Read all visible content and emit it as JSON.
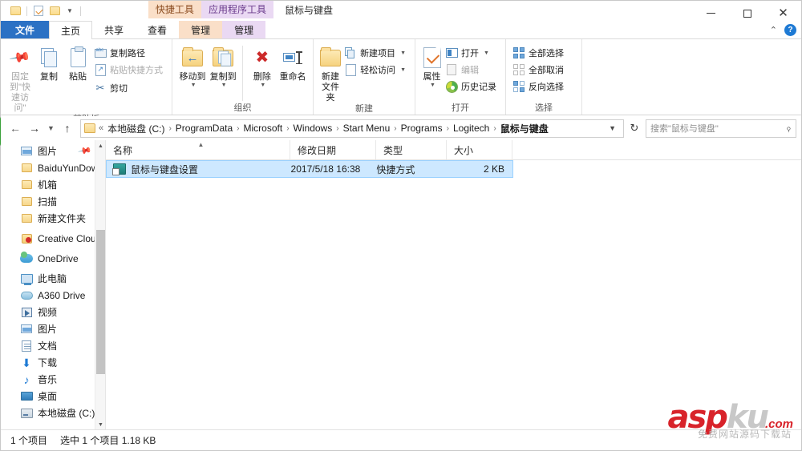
{
  "window": {
    "title": "鼠标与键盘",
    "quick_access": [
      {
        "name": "qat-folder-icon",
        "icon": "folder-mini"
      },
      {
        "name": "qat-properties-icon",
        "icon": "properties-mini"
      },
      {
        "name": "qat-newfolder-icon",
        "icon": "folder-mini"
      }
    ],
    "contextual_tabs": [
      {
        "label": "快捷工具",
        "sub": "管理",
        "color": "#fadfc8",
        "kind": "shortcut"
      },
      {
        "label": "应用程序工具",
        "sub": "管理",
        "color": "#ead9f3",
        "kind": "appcmd"
      }
    ],
    "controls": {
      "minimize": "minimize-icon",
      "maximize": "maximize-icon",
      "close": "close-icon"
    }
  },
  "ribbon": {
    "tabs": [
      {
        "label": "文件",
        "state": "file"
      },
      {
        "label": "主页",
        "state": "active"
      },
      {
        "label": "共享",
        "state": "normal"
      },
      {
        "label": "查看",
        "state": "normal"
      },
      {
        "label": "管理",
        "state": "ctx-shortcut"
      },
      {
        "label": "管理",
        "state": "ctx-appcmd"
      }
    ],
    "collapse_icon": "chevron-up-icon",
    "help_label": "?",
    "groups": [
      {
        "label": "剪贴板",
        "big": [
          {
            "label": "固定到\"快\n速访问\"",
            "line1": "固定到\"快",
            "line2": "速访问\"",
            "icon": "pin-icon",
            "dim": true
          },
          {
            "label": "复制",
            "line1": "复制",
            "line2": "",
            "icon": "copy-icon",
            "dim": false
          },
          {
            "label": "粘贴",
            "line1": "粘贴",
            "line2": "",
            "icon": "paste-icon",
            "dim": false
          }
        ],
        "small": [
          {
            "label": "复制路径",
            "icon": "copy-path-icon",
            "dim": false
          },
          {
            "label": "粘贴快捷方式",
            "icon": "paste-shortcut-icon",
            "dim": true
          },
          {
            "label": "剪切",
            "icon": "cut-icon",
            "dim": false
          }
        ]
      },
      {
        "label": "组织",
        "big": [
          {
            "line1": "移动到",
            "line2": "",
            "icon": "move-to-icon",
            "caret": true
          },
          {
            "line1": "复制到",
            "line2": "",
            "icon": "copy-to-icon",
            "caret": true
          },
          {
            "line1": "删除",
            "line2": "",
            "icon": "delete-icon",
            "caret": true
          },
          {
            "line1": "重命名",
            "line2": "",
            "icon": "rename-icon",
            "caret": false
          }
        ]
      },
      {
        "label": "新建",
        "big": [
          {
            "line1": "新建",
            "line2": "文件夹",
            "icon": "new-folder-icon",
            "caret": false
          }
        ],
        "small": [
          {
            "label": "新建项目",
            "icon": "new-item-icon",
            "caret": true
          },
          {
            "label": "轻松访问",
            "icon": "easy-access-icon",
            "caret": true
          }
        ]
      },
      {
        "label": "打开",
        "big": [
          {
            "line1": "属性",
            "line2": "",
            "icon": "properties-icon",
            "caret": true
          }
        ],
        "small": [
          {
            "label": "打开",
            "icon": "open-icon",
            "caret": true,
            "dim": false
          },
          {
            "label": "编辑",
            "icon": "edit-icon",
            "caret": false,
            "dim": true
          },
          {
            "label": "历史记录",
            "icon": "history-icon",
            "caret": false,
            "dim": false
          }
        ]
      },
      {
        "label": "选择",
        "small": [
          {
            "label": "全部选择",
            "icon": "select-all-icon"
          },
          {
            "label": "全部取消",
            "icon": "select-none-icon"
          },
          {
            "label": "反向选择",
            "icon": "invert-selection-icon"
          }
        ]
      }
    ]
  },
  "address": {
    "back_icon": "back-arrow-icon",
    "forward_icon": "forward-arrow-icon",
    "recent_icon": "chevron-down-icon",
    "up_icon": "up-arrow-icon",
    "lead_chevron": "«",
    "breadcrumbs": [
      "本地磁盘 (C:)",
      "ProgramData",
      "Microsoft",
      "Windows",
      "Start Menu",
      "Programs",
      "Logitech",
      "鼠标与键盘"
    ],
    "separator": "›",
    "dropdown_icon": "chevron-down-icon",
    "refresh_icon": "refresh-icon",
    "search_placeholder": "搜索\"鼠标与键盘\"",
    "search_value": "",
    "search_icon": "search-icon"
  },
  "navpane": {
    "items": [
      {
        "label": "图片",
        "icon": "pictures-icon",
        "indent": 1,
        "pinned": true
      },
      {
        "label": "BaiduYunDownload",
        "icon": "folder-icon",
        "indent": 2
      },
      {
        "label": "机箱",
        "icon": "folder-icon",
        "indent": 2
      },
      {
        "label": "扫描",
        "icon": "folder-icon",
        "indent": 2
      },
      {
        "label": "新建文件夹",
        "icon": "folder-icon",
        "indent": 2
      },
      {
        "label": "Creative Cloud Files",
        "icon": "creative-cloud-icon",
        "indent": 1
      },
      {
        "label": "OneDrive",
        "icon": "onedrive-icon",
        "indent": 1
      },
      {
        "label": "此电脑",
        "icon": "this-pc-icon",
        "indent": 1
      },
      {
        "label": "A360 Drive",
        "icon": "a360-drive-icon",
        "indent": 2
      },
      {
        "label": "视频",
        "icon": "videos-icon",
        "indent": 2
      },
      {
        "label": "图片",
        "icon": "pictures-icon",
        "indent": 2
      },
      {
        "label": "文档",
        "icon": "documents-icon",
        "indent": 2
      },
      {
        "label": "下载",
        "icon": "downloads-icon",
        "indent": 2
      },
      {
        "label": "音乐",
        "icon": "music-icon",
        "indent": 2
      },
      {
        "label": "桌面",
        "icon": "desktop-icon",
        "indent": 2
      },
      {
        "label": "本地磁盘 (C:)",
        "icon": "local-disk-icon",
        "indent": 2
      }
    ],
    "scroll_up_icon": "chevron-up-icon",
    "scroll_down_icon": "chevron-down-icon"
  },
  "filelist": {
    "columns": [
      {
        "label": "名称",
        "sorted": true,
        "sort_icon": "sort-ascending-icon"
      },
      {
        "label": "修改日期",
        "sorted": false
      },
      {
        "label": "类型",
        "sorted": false
      },
      {
        "label": "大小",
        "sorted": false
      }
    ],
    "rows": [
      {
        "name": "鼠标与键盘设置",
        "date": "2017/5/18 16:38",
        "type": "快捷方式",
        "size": "2 KB",
        "icon": "shortcut-icon",
        "selected": true
      }
    ]
  },
  "statusbar": {
    "count_text": "1 个项目",
    "selection_text": "选中 1 个项目  1.18 KB"
  },
  "watermark": {
    "asp": "asp",
    "ku": "ku",
    "com": ".com",
    "subtitle": "免费网站源码下载站"
  },
  "colors": {
    "file_tab": "#2b71c4",
    "selection": "#cde8ff",
    "shortcut_tab": "#fadfc8",
    "appcmd_tab": "#ead9f3",
    "watermark_red": "#d8232a"
  }
}
